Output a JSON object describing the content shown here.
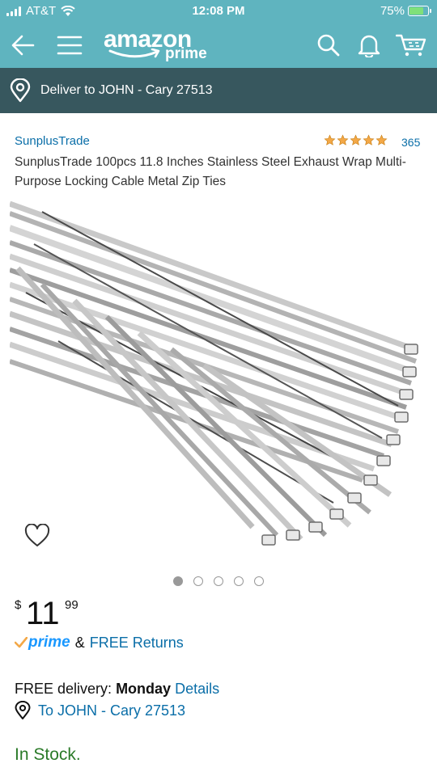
{
  "status_bar": {
    "carrier": "AT&T",
    "time": "12:08 PM",
    "battery": "75%"
  },
  "nav": {
    "logo_word": "amazon",
    "logo_sub": "prime",
    "icons": [
      "back-arrow-icon",
      "menu-icon",
      "search-icon",
      "bell-icon",
      "cart-icon"
    ]
  },
  "deliver": {
    "text": "Deliver to JOHN - Cary 27513"
  },
  "product": {
    "brand": "SunplusTrade",
    "rating_count": "365",
    "rating_stars": 5,
    "title": "SunplusTrade 100pcs 11.8 Inches Stainless Steel Exhaust Wrap Multi-Purpose Locking Cable Metal Zip Ties",
    "image_dots_total": 5,
    "image_dots_active": 1
  },
  "price": {
    "currency": "$",
    "whole": "11",
    "fraction": "99"
  },
  "prime_row": {
    "prime": "prime",
    "amp": "&",
    "free_returns": "FREE Returns"
  },
  "delivery": {
    "label": "FREE delivery:",
    "day": "Monday",
    "details": "Details",
    "ship_to": "To JOHN - Cary 27513"
  },
  "stock": "In Stock.",
  "colors": {
    "header": "#5fb4bf",
    "deliver_bar": "#37575e",
    "link": "#0a6ea8",
    "in_stock": "#2a7a28",
    "star": "#f3a847"
  }
}
